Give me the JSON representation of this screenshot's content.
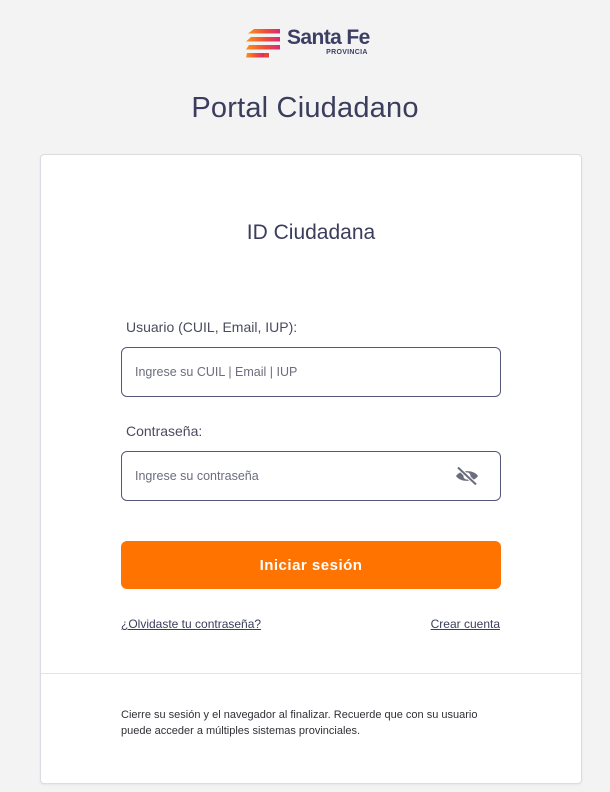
{
  "logo": {
    "name": "Santa Fe",
    "subtitle": "PROVINCIA",
    "icon": "santa-fe-stripes-logo"
  },
  "page": {
    "title": "Portal Ciudadano"
  },
  "card": {
    "title": "ID Ciudadana",
    "username": {
      "label": "Usuario (CUIL, Email, IUP):",
      "placeholder": "Ingrese su CUIL | Email | IUP",
      "value": ""
    },
    "password": {
      "label": "Contraseña:",
      "placeholder": "Ingrese su contraseña",
      "value": "",
      "toggle_icon": "eye-off-icon"
    },
    "login_button": "Iniciar sesión",
    "forgot_link": "¿Olvidaste tu contraseña?",
    "create_link": "Crear cuenta",
    "notice": "Cierre su sesión y el navegador al finalizar. Recuerde que con su usuario puede acceder a múltiples sistemas provinciales."
  },
  "colors": {
    "accent": "#ff7300",
    "text_primary": "#3a3d5c",
    "background": "#f3f3f4",
    "logo_orange": "#f7931e",
    "logo_red": "#e8423a",
    "logo_magenta": "#d62a7a"
  }
}
